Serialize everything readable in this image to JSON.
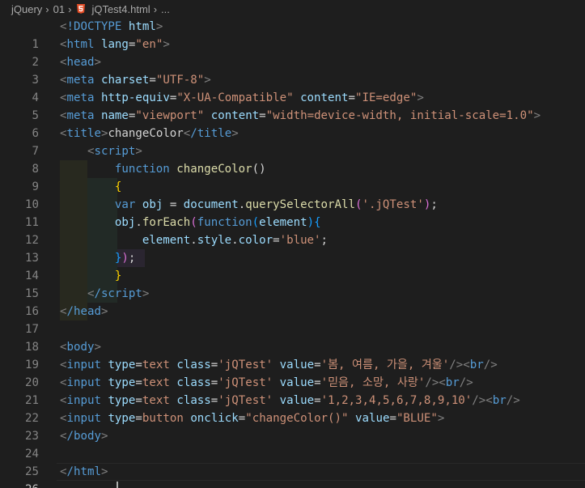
{
  "breadcrumb": {
    "folder1": "jQuery",
    "folder2": "01",
    "file": "jQTest4.html",
    "more": "..."
  },
  "editor": {
    "line_numbers": [
      "1",
      "2",
      "3",
      "4",
      "5",
      "6",
      "7",
      "8",
      "9",
      "10",
      "11",
      "12",
      "13",
      "14",
      "15",
      "16",
      "17",
      "18",
      "19",
      "20",
      "21",
      "22",
      "23",
      "24",
      "25",
      "26"
    ],
    "active_line": "26",
    "lines": {
      "l1": {
        "doctype": "!DOCTYPE",
        "html": "html"
      },
      "l2": {
        "tag": "html",
        "attr": "lang",
        "val": "\"en\""
      },
      "l3": {
        "tag": "head"
      },
      "l4": {
        "tag": "meta",
        "attr": "charset",
        "val": "\"UTF-8\""
      },
      "l5": {
        "tag": "meta",
        "attr1": "http-equiv",
        "val1": "\"X-UA-Compatible\"",
        "attr2": "content",
        "val2": "\"IE=edge\""
      },
      "l6": {
        "tag": "meta",
        "attr1": "name",
        "val1": "\"viewport\"",
        "attr2": "content",
        "val2": "\"width=device-width, initial-scale=1.0\""
      },
      "l7": {
        "tag": "title",
        "text": "changeColor",
        "close": "/title"
      },
      "l8": {
        "tag": "script"
      },
      "l9": {
        "keyword": "function",
        "name": "changeColor",
        "parens": "()"
      },
      "l10": {
        "brace": "{"
      },
      "l11": {
        "keyword": "var",
        "obj": "obj",
        "eq": " = ",
        "doc": "document",
        "dot": ".",
        "method": "querySelectorAll",
        "open": "(",
        "arg": "'.jQTest'",
        "close": ")",
        "semi": ";"
      },
      "l12": {
        "obj": "obj",
        "dot": ".",
        "method": "forEach",
        "open": "(",
        "keyword": "function",
        "popen": "(",
        "param": "element",
        "pclose": ")",
        "brace": "{"
      },
      "l13": {
        "el": "element",
        "dot1": ".",
        "style": "style",
        "dot2": ".",
        "color": "color",
        "eq": "=",
        "val": "'blue'",
        "semi": ";"
      },
      "l14": {
        "brace": "}",
        "paren": ")",
        "semi": ";"
      },
      "l15": {
        "brace": "}"
      },
      "l16": {
        "tag": "/script"
      },
      "l17": {
        "tag": "/head"
      },
      "l19": {
        "tag": "body"
      },
      "l20": {
        "tag": "input",
        "a1": "type",
        "v1": "text",
        "a2": "class",
        "v2": "'jQTest'",
        "a3": "value",
        "v3": "'봄, 여름, 가을, 겨울'",
        "br": "br"
      },
      "l21": {
        "tag": "input",
        "a1": "type",
        "v1": "text",
        "a2": "class",
        "v2": "'jQTest'",
        "a3": "value",
        "v3": "'믿음, 소망, 사랑'",
        "br": "br"
      },
      "l22": {
        "tag": "input",
        "a1": "type",
        "v1": "text",
        "a2": "class",
        "v2": "'jQTest'",
        "a3": "value",
        "v3": "'1,2,3,4,5,6,7,8,9,10'",
        "br": "br"
      },
      "l23": {
        "tag": "input",
        "a1": "type",
        "v1": "button",
        "a2": "onclick",
        "v2": "\"changeColor()\"",
        "a3": "value",
        "v3": "\"BLUE\""
      },
      "l24": {
        "tag": "/body"
      },
      "l26": {
        "tag": "/html"
      }
    }
  },
  "colors": {
    "background": "#1e1e1e",
    "tag": "#569cd6",
    "attribute": "#9cdcfe",
    "string": "#ce9178",
    "function": "#dcdcaa",
    "punctuation": "#808080"
  }
}
